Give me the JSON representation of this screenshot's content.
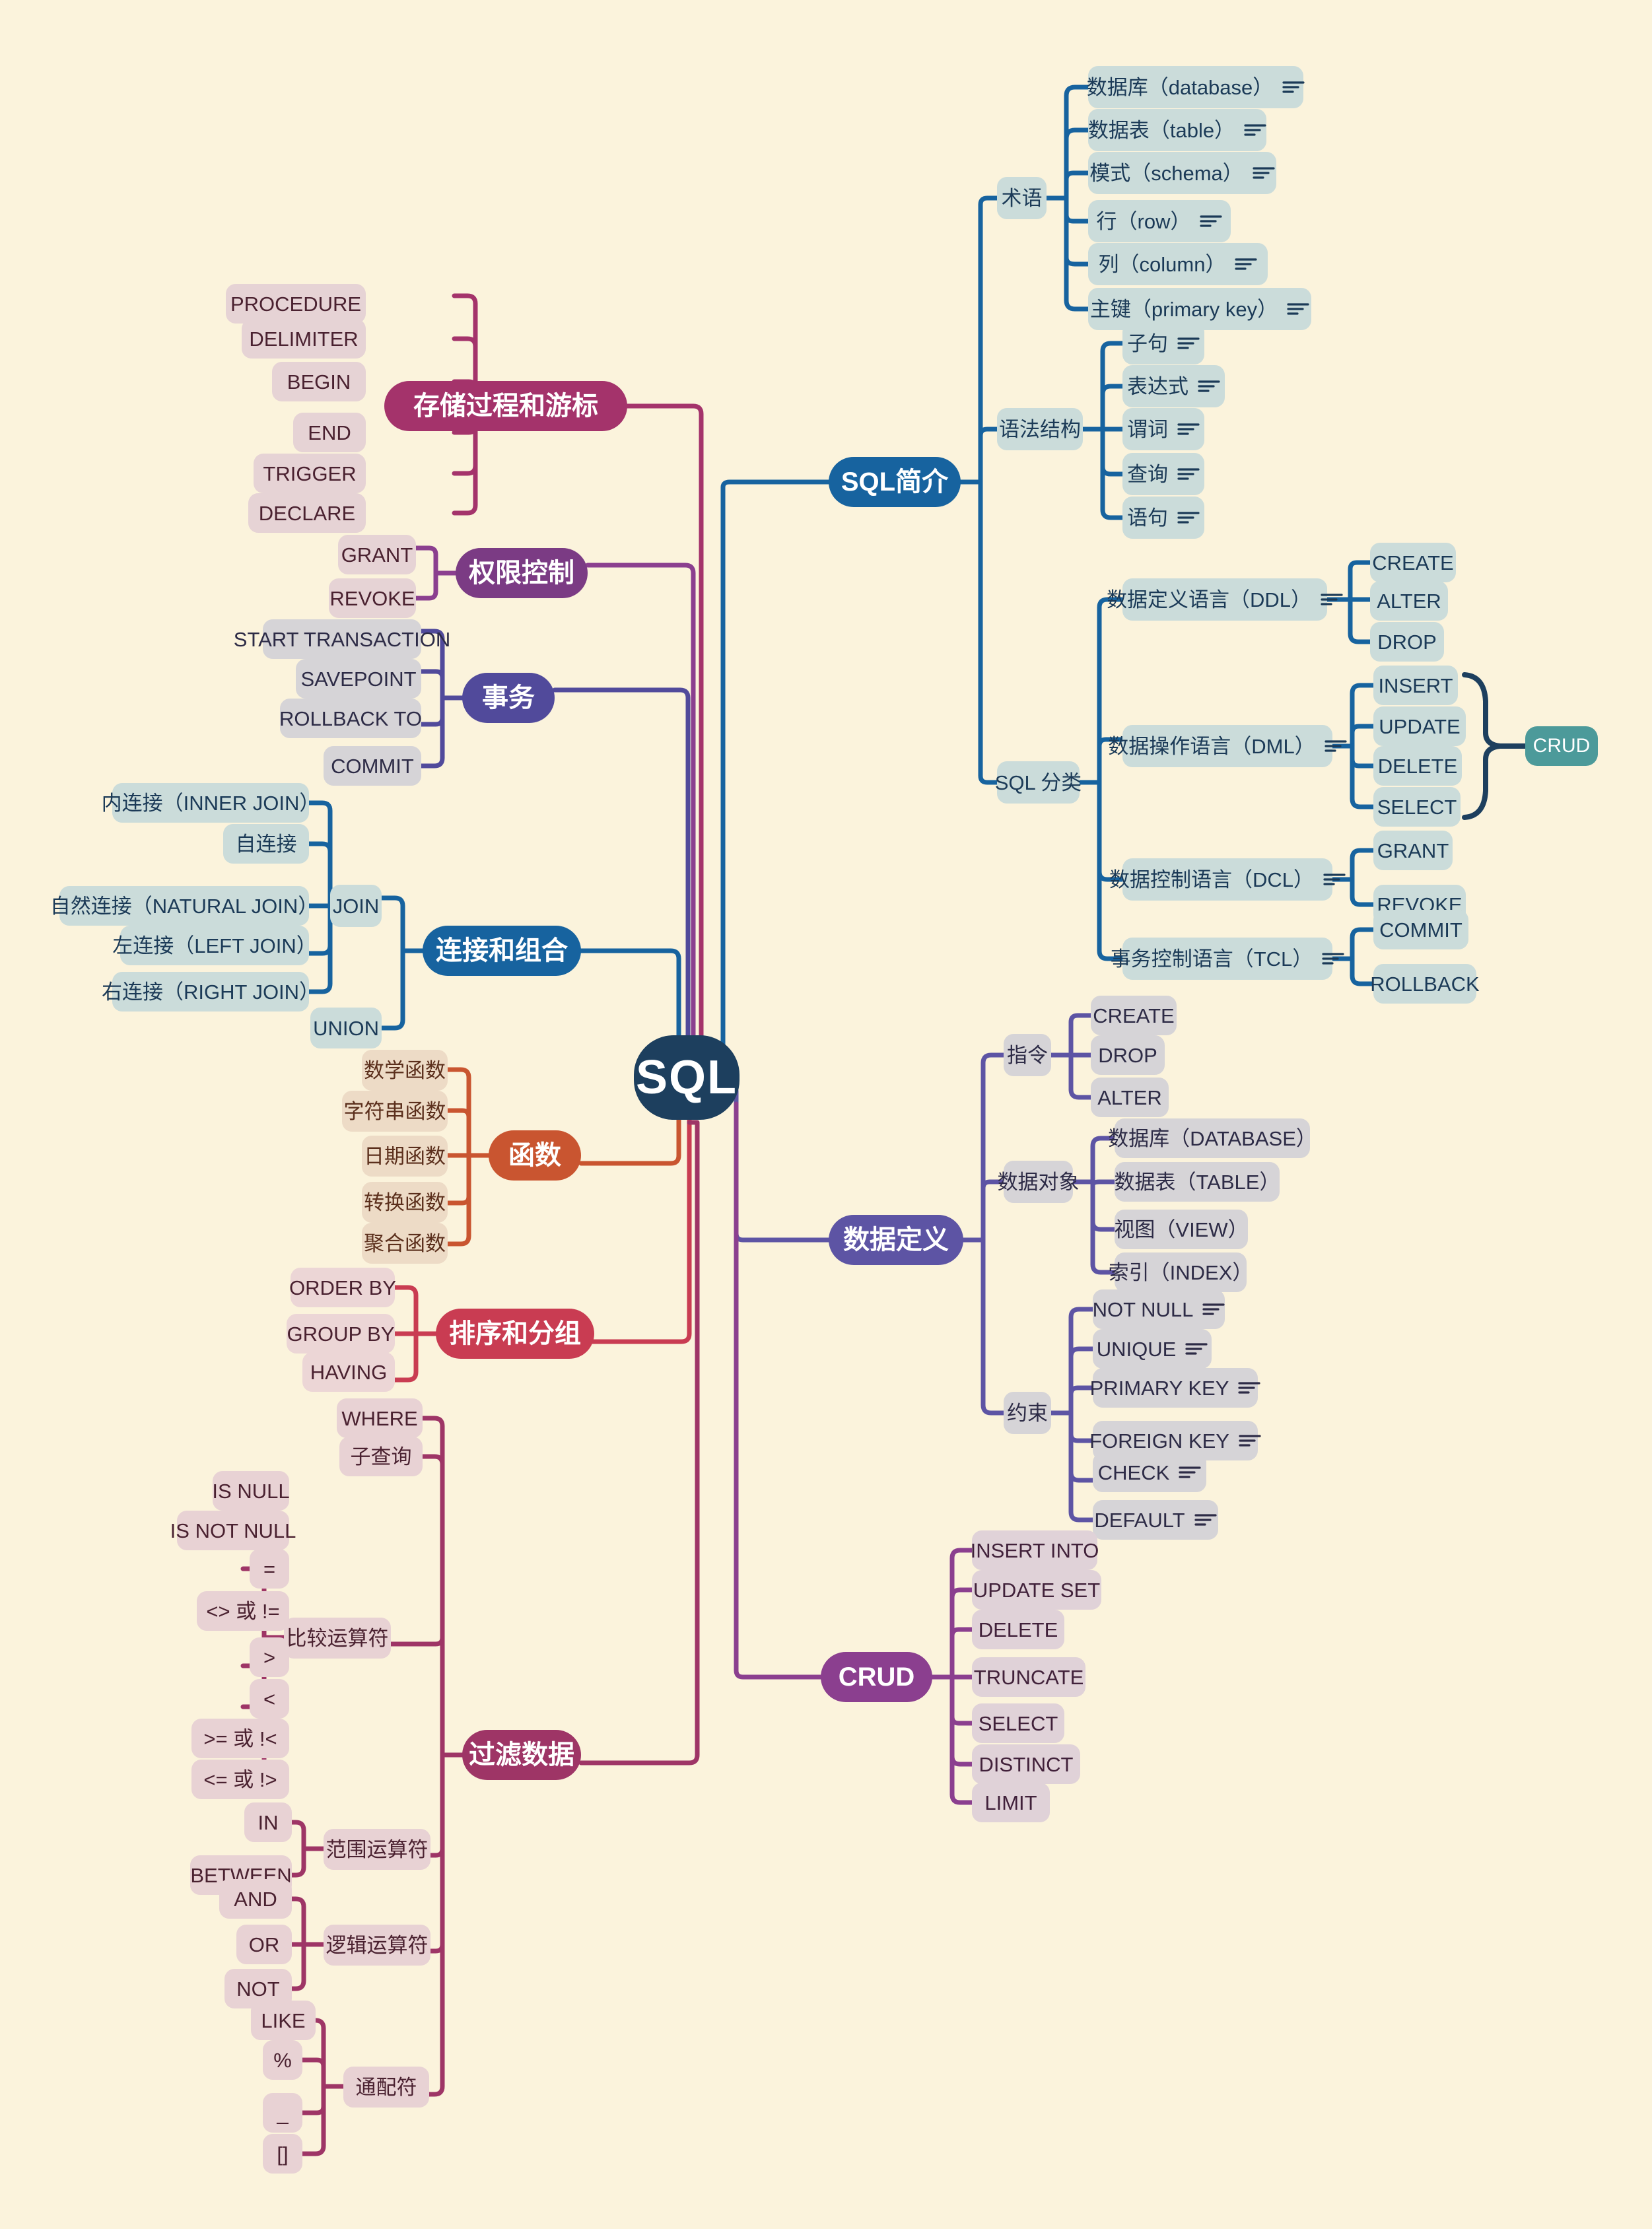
{
  "title": "SQL",
  "theme": {
    "background": "#fbf3dc",
    "root": "#1d3f5e",
    "blue": "#17639f",
    "violet": "#5d54a4",
    "purple": "#8b3f8f",
    "indigo": "#514a9b",
    "magenta": "#a4336b",
    "crimson": "#c93c52",
    "orange": "#c95530",
    "wine": "#9e3566",
    "badge_teal": "#4c9a9a"
  },
  "root": {
    "label": "SQL"
  },
  "branches": {
    "sql_intro": {
      "label": "SQL简介",
      "children": [
        {
          "label": "术语",
          "items": [
            {
              "label": "数据库（database）",
              "note": true
            },
            {
              "label": "数据表（table）",
              "note": true
            },
            {
              "label": "模式（schema）",
              "note": true
            },
            {
              "label": "行（row）",
              "note": true
            },
            {
              "label": "列（column）",
              "note": true
            },
            {
              "label": "主键（primary key）",
              "note": true
            }
          ]
        },
        {
          "label": "语法结构",
          "items": [
            {
              "label": "子句",
              "note": true
            },
            {
              "label": "表达式",
              "note": true
            },
            {
              "label": "谓词",
              "note": true
            },
            {
              "label": "查询",
              "note": true
            },
            {
              "label": "语句",
              "note": true
            }
          ]
        },
        {
          "label": "SQL 分类",
          "items": [
            {
              "label": "数据定义语言（DDL）",
              "note": true,
              "items": [
                "CREATE",
                "ALTER",
                "DROP"
              ]
            },
            {
              "label": "数据操作语言（DML）",
              "note": true,
              "items": [
                "INSERT",
                "UPDATE",
                "DELETE",
                "SELECT"
              ],
              "badge": "CRUD"
            },
            {
              "label": "数据控制语言（DCL）",
              "note": true,
              "items": [
                "GRANT",
                "REVOKE"
              ]
            },
            {
              "label": "事务控制语言（TCL）",
              "note": true,
              "items": [
                "COMMIT",
                "ROLLBACK"
              ]
            }
          ]
        }
      ]
    },
    "data_definition": {
      "label": "数据定义",
      "children": [
        {
          "label": "指令",
          "items": [
            "CREATE",
            "DROP",
            "ALTER"
          ]
        },
        {
          "label": "数据对象",
          "items": [
            "数据库（DATABASE）",
            "数据表（TABLE）",
            "视图（VIEW）",
            "索引（INDEX）"
          ]
        },
        {
          "label": "约束",
          "items": [
            {
              "label": "NOT NULL",
              "note": true
            },
            {
              "label": "UNIQUE",
              "note": true
            },
            {
              "label": "PRIMARY KEY",
              "note": true
            },
            {
              "label": "FOREIGN KEY",
              "note": true
            },
            {
              "label": "CHECK",
              "note": true
            },
            {
              "label": "DEFAULT",
              "note": true
            }
          ]
        }
      ]
    },
    "crud": {
      "label": "CRUD",
      "items": [
        "INSERT INTO",
        "UPDATE SET",
        "DELETE",
        "TRUNCATE",
        "SELECT",
        "DISTINCT",
        "LIMIT"
      ]
    },
    "stored_procedure": {
      "label": "存储过程和游标",
      "items": [
        "PROCEDURE",
        "DELIMITER",
        "BEGIN",
        "END",
        "TRIGGER",
        "DECLARE"
      ]
    },
    "privileges": {
      "label": "权限控制",
      "items": [
        "GRANT",
        "REVOKE"
      ]
    },
    "transaction": {
      "label": "事务",
      "items": [
        "START TRANSACTION",
        "SAVEPOINT",
        "ROLLBACK TO",
        "COMMIT"
      ]
    },
    "join_union": {
      "label": "连接和组合",
      "children": [
        {
          "label": "JOIN",
          "items": [
            "内连接（INNER JOIN）",
            "自连接",
            "自然连接（NATURAL JOIN）",
            "左连接（LEFT JOIN）",
            "右连接（RIGHT JOIN）"
          ]
        },
        {
          "label": "UNION",
          "items": []
        }
      ]
    },
    "functions": {
      "label": "函数",
      "items": [
        "数学函数",
        "字符串函数",
        "日期函数",
        "转换函数",
        "聚合函数"
      ]
    },
    "order_group": {
      "label": "排序和分组",
      "items": [
        "ORDER BY",
        "GROUP BY",
        "HAVING"
      ]
    },
    "filter": {
      "label": "过滤数据",
      "direct_items": [
        "WHERE",
        "子查询"
      ],
      "children": [
        {
          "label": "比较运算符",
          "items": [
            "IS NULL",
            "IS NOT NULL",
            "=",
            "<> 或 !=",
            ">",
            "<",
            ">= 或 !<",
            "<= 或 !>"
          ]
        },
        {
          "label": "范围运算符",
          "items": [
            "IN",
            "BETWEEN"
          ]
        },
        {
          "label": "逻辑运算符",
          "items": [
            "AND",
            "OR",
            "NOT"
          ]
        },
        {
          "label": "通配符",
          "items": [
            "LIKE",
            "%",
            "_",
            "[]"
          ]
        }
      ]
    }
  }
}
